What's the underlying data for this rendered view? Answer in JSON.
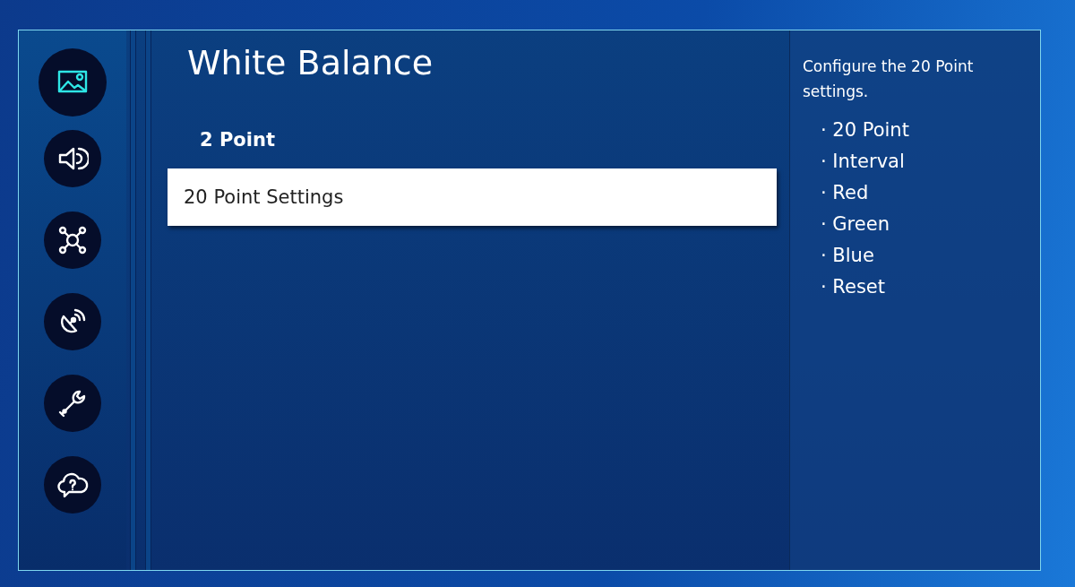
{
  "sidebar": {
    "items": [
      {
        "kind": "picture",
        "selected": true
      },
      {
        "kind": "sound",
        "selected": false
      },
      {
        "kind": "network",
        "selected": false
      },
      {
        "kind": "broadcast",
        "selected": false
      },
      {
        "kind": "support",
        "selected": false
      },
      {
        "kind": "help",
        "selected": false
      }
    ]
  },
  "title": "White Balance",
  "menu": [
    {
      "label": "2 Point",
      "selected": false
    },
    {
      "label": "20 Point Settings",
      "selected": true
    }
  ],
  "help_panel": {
    "description": "Configure the 20 Point settings.",
    "items": [
      "· 20 Point",
      "· Interval",
      "· Red",
      "· Green",
      "· Blue",
      "· Reset"
    ]
  }
}
